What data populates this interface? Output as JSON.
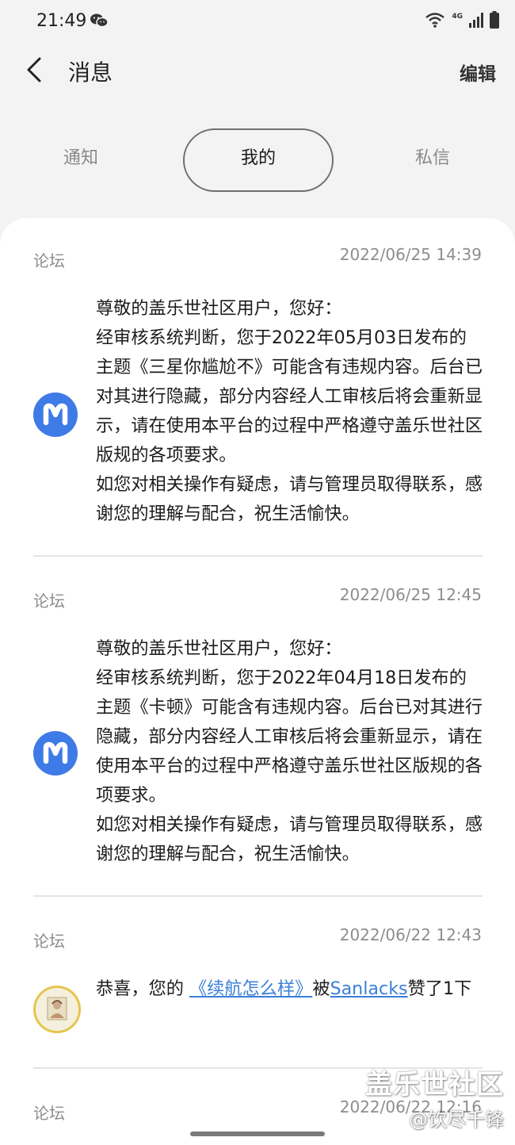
{
  "status_bar": {
    "time": "21:49",
    "network": "4G"
  },
  "header": {
    "title": "消息",
    "edit_label": "编辑"
  },
  "tabs": [
    {
      "label": "通知",
      "selected": false
    },
    {
      "label": "我的",
      "selected": true
    },
    {
      "label": "私信",
      "selected": false
    }
  ],
  "messages": [
    {
      "source": "论坛",
      "time": "2022/06/25 14:39",
      "avatar": "m-logo-icon",
      "text": "尊敬的盖乐世社区用户，您好：\n经审核系统判断，您于2022年05月03日发布的主题《三星你尴尬不》可能含有违规内容。后台已对其进行隐藏，部分内容经人工审核后将会重新显示，请在使用本平台的过程中严格遵守盖乐世社区版规的各项要求。\n如您对相关操作有疑虑，请与管理员取得联系，感谢您的理解与配合，祝生活愉快。"
    },
    {
      "source": "论坛",
      "time": "2022/06/25 12:45",
      "avatar": "m-logo-icon",
      "text": "尊敬的盖乐世社区用户，您好：\n经审核系统判断，您于2022年04月18日发布的主题《卡顿》可能含有违规内容。后台已对其进行隐藏，部分内容经人工审核后将会重新显示，请在使用本平台的过程中严格遵守盖乐世社区版规的各项要求。\n如您对相关操作有疑虑，请与管理员取得联系，感谢您的理解与配合，祝生活愉快。"
    },
    {
      "source": "论坛",
      "time": "2022/06/22 12:43",
      "avatar": "user-avatar",
      "text_prefix": "恭喜，您的 ",
      "link_post": "《续航怎么样》",
      "text_middle": "被",
      "link_user": "Sanlacks",
      "text_suffix": "赞了1下"
    },
    {
      "source": "论坛",
      "time": "2022/06/22 12:16"
    }
  ],
  "watermark": {
    "main": "盖乐世社区",
    "sub": "@饮尽千锋"
  },
  "colors": {
    "accent_link": "#3b7fd8",
    "avatar_blue": "#3f7be7",
    "background": "#f3f3f3"
  }
}
